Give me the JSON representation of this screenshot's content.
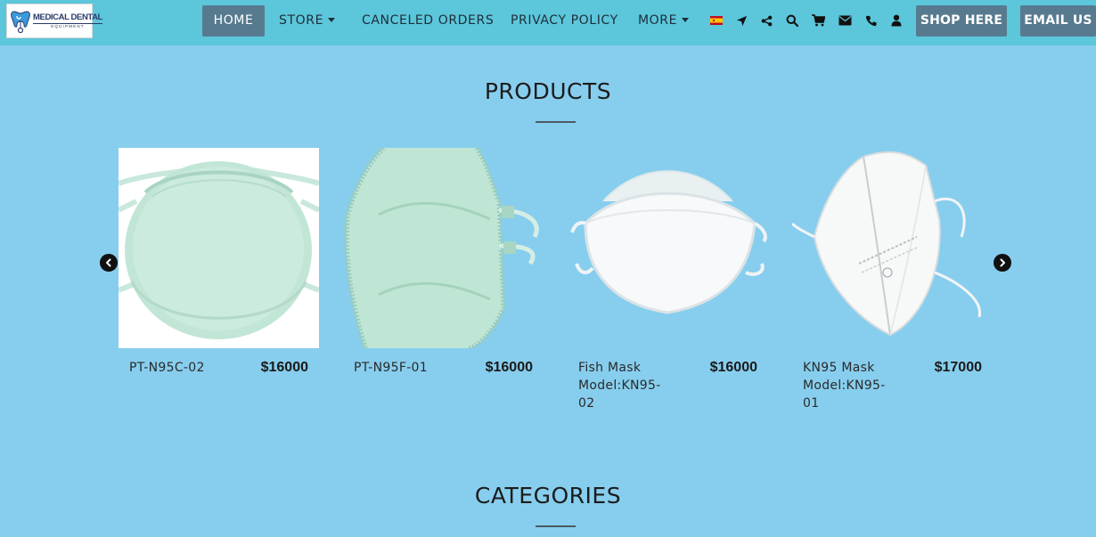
{
  "header": {
    "logo": {
      "title": "MEDICAL DENTAL",
      "subtitle": "EQUIPMENT"
    },
    "nav": {
      "home": "HOME",
      "store": "STORE",
      "canceled_orders": "CANCELED ORDERS",
      "privacy_policy": "PRIVACY POLICY",
      "more": "MORE"
    },
    "icons": [
      "spain-flag-icon",
      "location-arrow-icon",
      "share-icon",
      "search-icon",
      "cart-icon",
      "envelope-icon",
      "phone-icon",
      "user-icon"
    ],
    "shop_button": "SHOP HERE",
    "email_button": "EMAIL US"
  },
  "products": {
    "title": "PRODUCTS",
    "items": [
      {
        "name": "PT-N95C-02",
        "price": "$16000"
      },
      {
        "name": "PT-N95F-01",
        "price": "$16000"
      },
      {
        "name": "Fish Mask Model:KN95-02",
        "price": "$16000"
      },
      {
        "name": "KN95 Mask Model:KN95-01",
        "price": "$17000"
      }
    ]
  },
  "categories": {
    "title": "CATEGORIES"
  },
  "colors": {
    "page_background": "#87ceee",
    "navbar_background": "#5cc6da",
    "button_background": "#577a8f",
    "button_text": "#ffffff"
  }
}
